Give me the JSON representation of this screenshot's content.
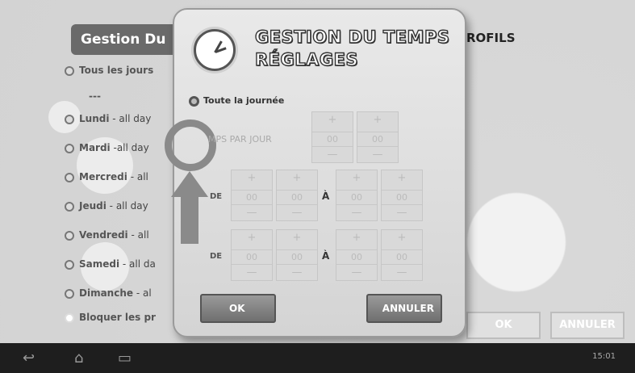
{
  "background": {
    "title": "Gestion Du",
    "profiles": "ROFILS",
    "dash": "---",
    "days": [
      {
        "name": "Tous les jours",
        "suffix": ""
      },
      {
        "name": "Lundi",
        "suffix": " - all day"
      },
      {
        "name": "Mardi",
        "suffix": " -all day"
      },
      {
        "name": "Mercredi",
        "suffix": " - all"
      },
      {
        "name": "Jeudi",
        "suffix": " - all day"
      },
      {
        "name": "Vendredi",
        "suffix": " - all"
      },
      {
        "name": "Samedi",
        "suffix": " - all da"
      },
      {
        "name": "Dimanche",
        "suffix": " - al"
      },
      {
        "name": "Bloquer les pr",
        "suffix": ""
      }
    ],
    "ok_label": "OK",
    "cancel_label": "ANNULER"
  },
  "modal": {
    "title_line1": "GESTION DU TEMPS",
    "title_line2": "RÉGLAGES",
    "option_all_day": "Toute la journée",
    "option_time_per_day": "MPS PAR JOUR",
    "plus": "+",
    "minus": "—",
    "time_per_day": {
      "hours": "00",
      "minutes": "00"
    },
    "range1": {
      "from_label": "DE",
      "to_label": "À",
      "from_h": "00",
      "from_m": "00",
      "to_h": "00",
      "to_m": "00"
    },
    "range2": {
      "from_label": "DE",
      "to_label": "À",
      "from_h": "00",
      "from_m": "00",
      "to_h": "00",
      "to_m": "00"
    },
    "ok_label": "OK",
    "cancel_label": "ANNULER"
  },
  "navbar": {
    "back_icon": "↩",
    "home_icon": "⌂",
    "recent_icon": "▭",
    "time": "15:01"
  }
}
